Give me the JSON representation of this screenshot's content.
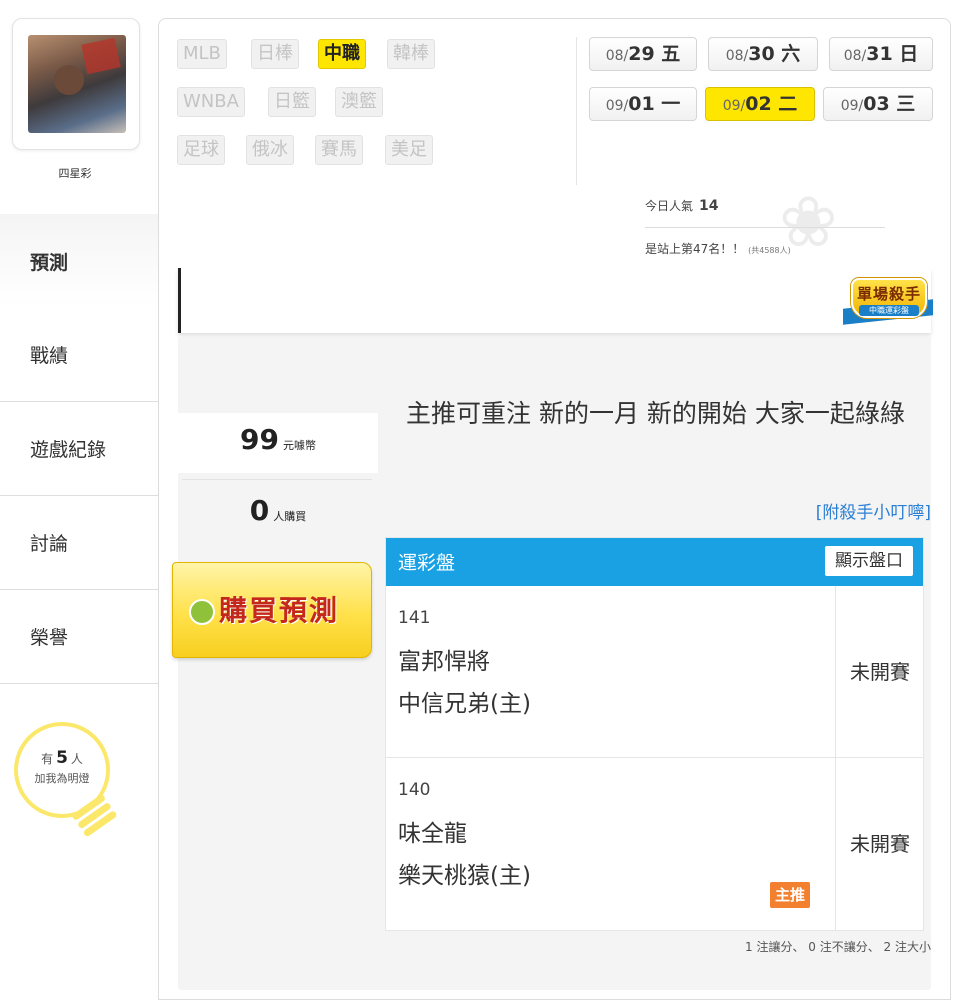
{
  "user": {
    "name": "四星彩"
  },
  "nav": {
    "items": [
      {
        "label": "預測",
        "active": true
      },
      {
        "label": "戰績",
        "active": false
      },
      {
        "label": "遊戲紀錄",
        "active": false
      },
      {
        "label": "討論",
        "active": false
      },
      {
        "label": "榮譽",
        "active": false
      }
    ]
  },
  "bulb": {
    "prefix": "有",
    "count": "5",
    "suffix": "人",
    "line2": "加我為明燈"
  },
  "sports": {
    "row1": [
      "MLB",
      "日棒",
      "中職",
      "韓棒"
    ],
    "row2": [
      "WNBA",
      "日籃",
      "澳籃"
    ],
    "row3": [
      "足球",
      "俄冰",
      "賽馬",
      "美足"
    ],
    "active": "中職"
  },
  "dates": [
    {
      "md": "08/",
      "day": "29 五",
      "active": false
    },
    {
      "md": "08/",
      "day": "30 六",
      "active": false
    },
    {
      "md": "08/",
      "day": "31 日",
      "active": false
    },
    {
      "md": "09/",
      "day": "01 一",
      "active": false
    },
    {
      "md": "09/",
      "day": "02 二",
      "active": true
    },
    {
      "md": "09/",
      "day": "03 三",
      "active": false
    }
  ],
  "popularity": {
    "label": "今日人氣",
    "value": "14",
    "rank_text": "是站上第47名！！",
    "rank_total": "(共4588人)"
  },
  "badge": {
    "title": "單場殺手",
    "subtitle": "中職運彩盤"
  },
  "stats": {
    "coins_value": "99",
    "coins_unit": "元噱幣",
    "buyers_value": "0",
    "buyers_unit": "人購買"
  },
  "buy_button": {
    "label": "購買預測",
    "coin_icon": "coin-icon"
  },
  "headline": "主推可重注 新的一月 新的開始 大家一起綠綠",
  "tips_link": "[附殺手小叮嚀]",
  "table": {
    "title": "運彩盤",
    "show_button": "顯示盤口",
    "games": [
      {
        "no": "141",
        "away": "富邦悍將",
        "home": "中信兄弟(主)",
        "status": "未開賽",
        "featured": false
      },
      {
        "no": "140",
        "away": "味全龍",
        "home": "樂天桃猿(主)",
        "status": "未開賽",
        "featured": true
      }
    ],
    "featured_tag": "主推",
    "summary": "1 注讓分、 0 注不讓分、 2 注大小"
  },
  "colors": {
    "accent_yellow": "#ffe600",
    "header_blue": "#1aa1e4",
    "link_blue": "#2a7fd4",
    "tag_orange": "#f2802f",
    "buy_red": "#c4281c"
  }
}
